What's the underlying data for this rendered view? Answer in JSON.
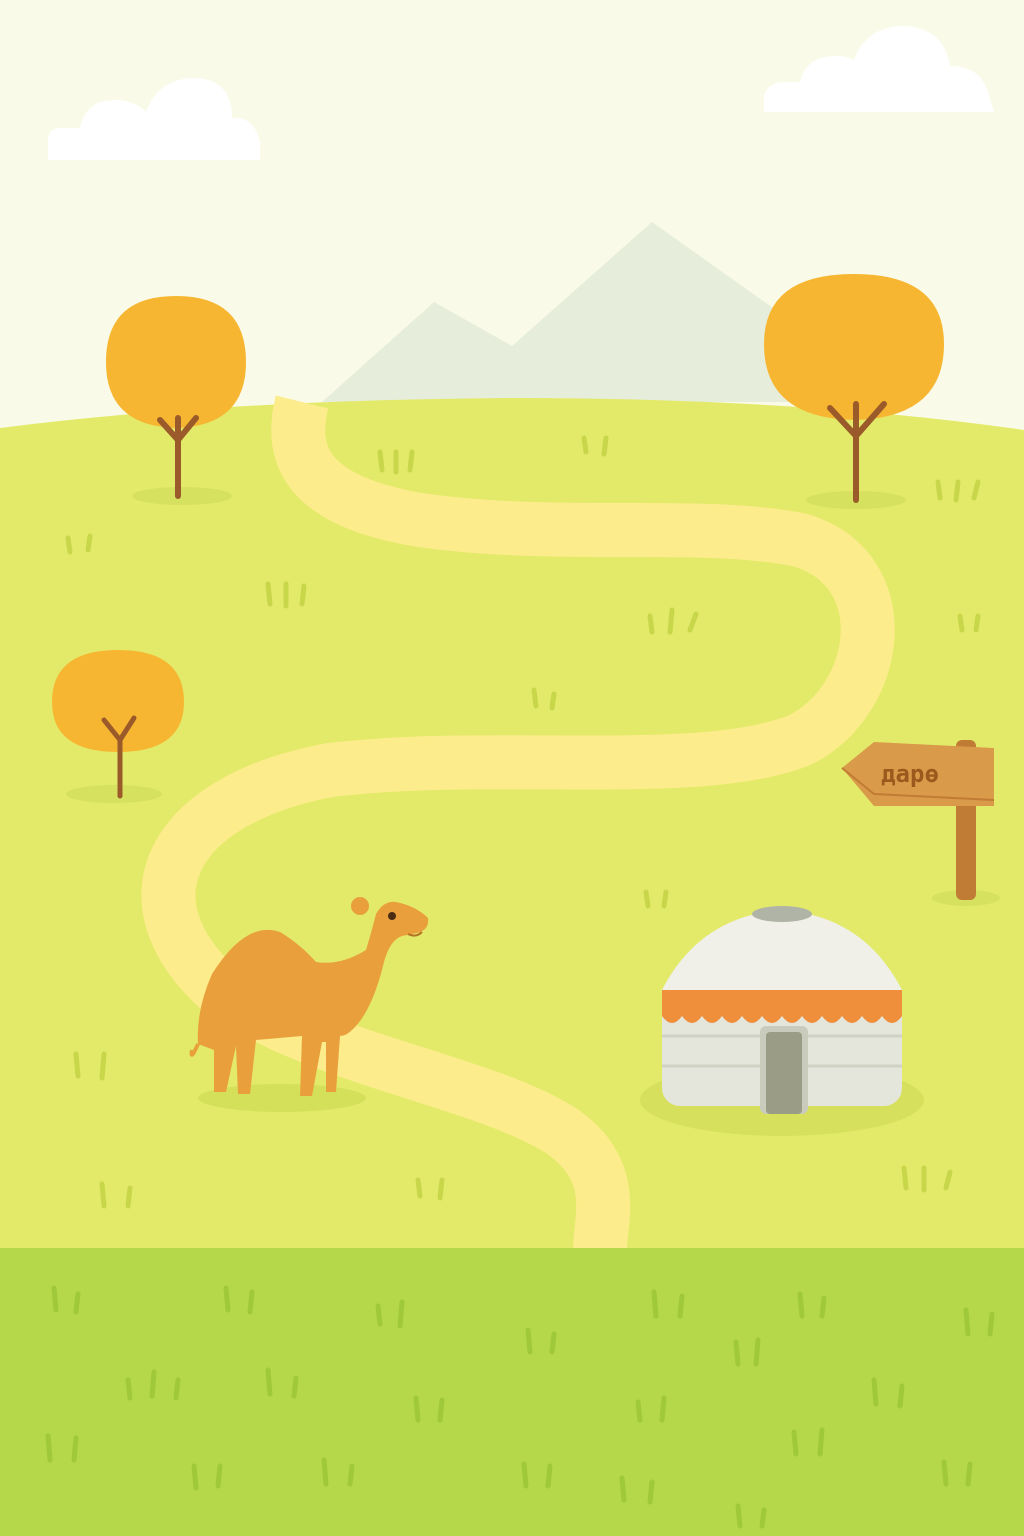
{
  "scene": {
    "signpost": {
      "label": "дарө"
    }
  },
  "colors": {
    "sky": "#f9fbe8",
    "mountain": "#e6eddb",
    "hill": "#e3ea6a",
    "foreground": "#b4d84a",
    "path": "#fdec8b",
    "tree_canopy": "#f7b631",
    "tree_trunk": "#9a5a2a",
    "camel": "#e9a03c",
    "yurt_wall": "#e4e6dc",
    "yurt_roof": "#f0f0e8",
    "yurt_trim": "#ef8e3b",
    "sign_wood": "#d99a49"
  },
  "icons": [
    "cloud-icon",
    "mountain-icon",
    "tree-icon",
    "camel-icon",
    "yurt-icon",
    "signpost-icon",
    "grass-tuft-icon"
  ]
}
